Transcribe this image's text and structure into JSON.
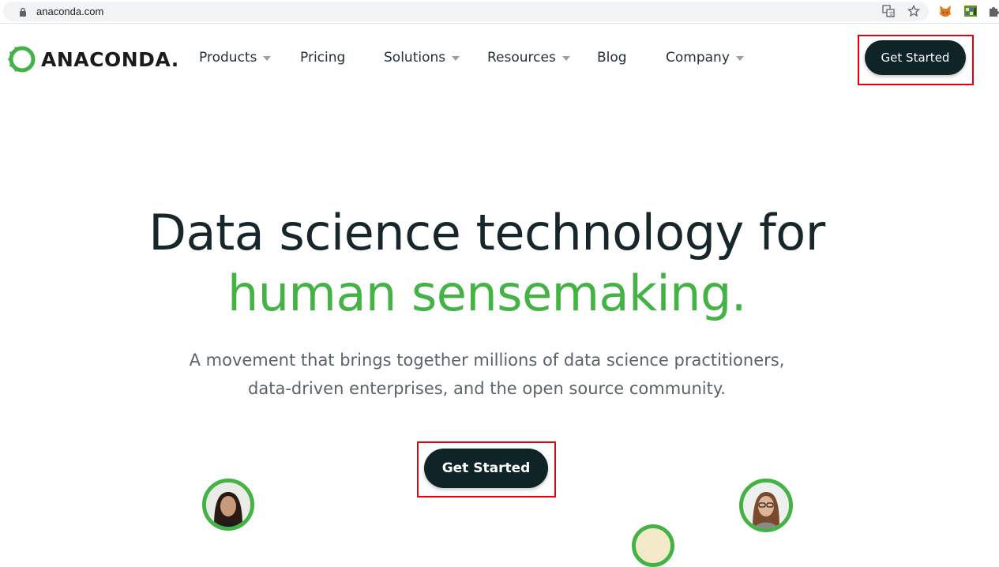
{
  "browser": {
    "url": "anaconda.com",
    "icons": [
      "translate-icon",
      "star-icon",
      "fox-extension-icon",
      "calendar-extension-icon",
      "puzzle-icon"
    ]
  },
  "header": {
    "logo_text": "ANACONDA.",
    "nav": [
      {
        "label": "Products",
        "has_dropdown": true
      },
      {
        "label": "Pricing",
        "has_dropdown": false
      },
      {
        "label": "Solutions",
        "has_dropdown": true
      },
      {
        "label": "Resources",
        "has_dropdown": true
      },
      {
        "label": "Blog",
        "has_dropdown": false
      },
      {
        "label": "Company",
        "has_dropdown": true
      }
    ],
    "cta_label": "Get Started"
  },
  "hero": {
    "title_line1": "Data science technology for",
    "title_line2": "human sensemaking.",
    "subtitle_line1": "A movement that brings together millions of data science practitioners,",
    "subtitle_line2": "data-driven enterprises, and the open source community.",
    "cta_label": "Get Started"
  },
  "colors": {
    "brand_green": "#44b244",
    "dark_button": "#0f2426",
    "highlight_red": "#e3000f"
  }
}
